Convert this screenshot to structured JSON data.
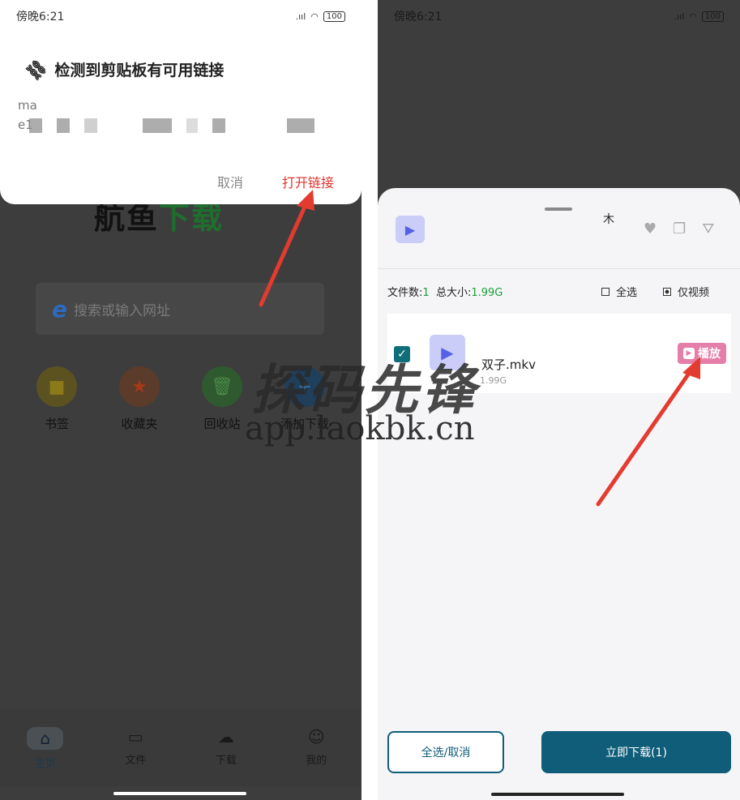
{
  "left": {
    "status": {
      "time": "傍晚6:21",
      "signal": ".ııl",
      "wifi": "wifi",
      "battery": "100"
    },
    "logo": {
      "part1": "航鱼",
      "part2": "下载"
    },
    "search": {
      "placeholder": "搜索或输入网址",
      "icon": "ie-icon"
    },
    "quick_actions": [
      {
        "label": "书签",
        "icon": "bookmark-icon",
        "color": "#5b5220"
      },
      {
        "label": "收藏夹",
        "icon": "star-icon",
        "color": "#5b3b2a"
      },
      {
        "label": "回收站",
        "icon": "trash-icon",
        "color": "#2f5a2f"
      },
      {
        "label": "添加下载",
        "icon": "add-download-icon",
        "color": "#1f3f5a"
      }
    ],
    "nav": [
      {
        "label": "主页",
        "icon": "home-icon"
      },
      {
        "label": "文件",
        "icon": "folder-icon"
      },
      {
        "label": "下载",
        "icon": "cloud-download-icon"
      },
      {
        "label": "我的",
        "icon": "profile-icon"
      }
    ],
    "dialog": {
      "title": "检测到剪贴板有可用链接",
      "url_line1": "ma",
      "url_line2": "e1",
      "cancel": "取消",
      "open": "打开链接"
    }
  },
  "right": {
    "status": {
      "time": "傍晚6:21",
      "signal": ".ııl",
      "battery": "100"
    },
    "sheet": {
      "title_line1": "木",
      "title_line2": "̈",
      "summary_label_count": "文件数:",
      "count": "1",
      "summary_label_size": "总大小:",
      "size": "1.99G",
      "select_all": "全选",
      "video_only": "仅视频",
      "file": {
        "name": "双子.mkv",
        "size": "1.99G",
        "play": "播放"
      },
      "btn_select": "全选/取消",
      "btn_download": "立即下载(1)"
    }
  },
  "watermark": {
    "line1": "探码先锋",
    "line2": "app.laokbk.cn"
  },
  "colors": {
    "accent": "#0f5d78",
    "red": "#e0302a",
    "pink": "#e57ea9",
    "green": "#1c9d3b"
  }
}
